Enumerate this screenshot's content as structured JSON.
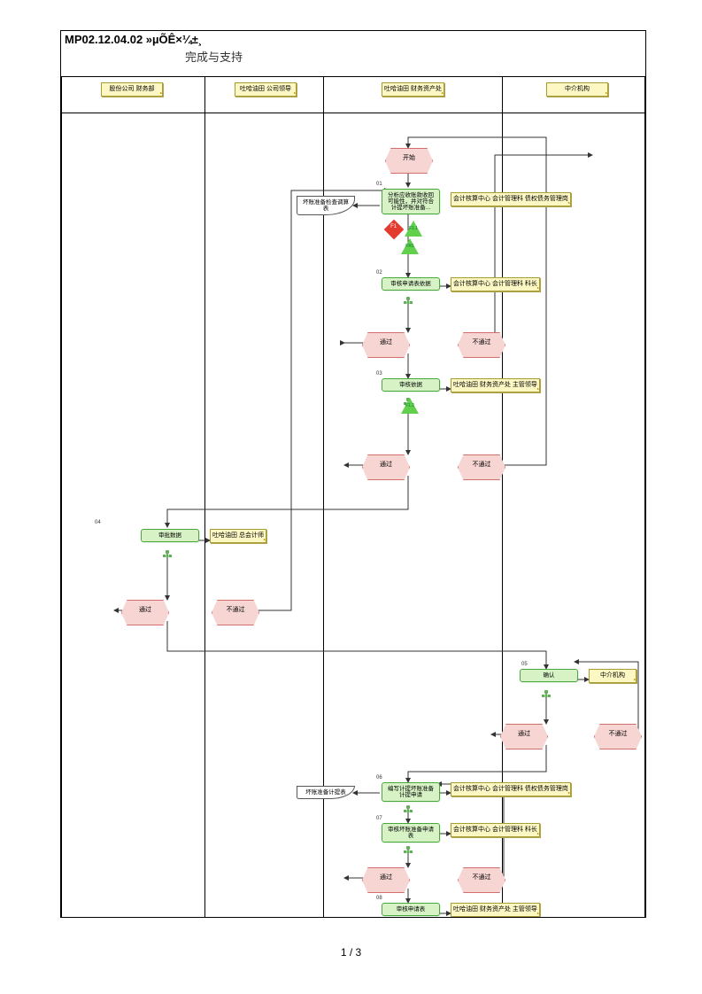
{
  "doc": {
    "code": "MP02.12.04.02 »µÕÊ×¼±¸",
    "subtitle": "完成与支持",
    "page_label": "1 / 3"
  },
  "lanes": {
    "l1": "股份公司\n财务部",
    "l2": "吐哈油田\n公司领导",
    "l3": "吐哈油田\n财务资产处",
    "l4": "中介机构"
  },
  "nodes": {
    "start": "开始",
    "s01": "分析应收账款收回可能性，并对符合计提坏账准备...",
    "s01_doc": "坏账准备检查调算表",
    "s01_org": "会计核算中心\n会计管理科\n债权债务管理岗",
    "s01_d": "F1",
    "s01_t1": "F1.1",
    "s01_t2": "FR1",
    "s02": "审核申请表依据",
    "s02_org": "会计核算中心\n会计管理科\n科长",
    "s02_pass": "通过",
    "s02_fail": "不通过",
    "s03": "审核依据",
    "s03_org": "吐哈油田\n财务资产处\n主管领导",
    "s03_t": "F1.2",
    "s03_pass": "通过",
    "s03_fail": "不通过",
    "s04": "审批数据",
    "s04_org": "吐哈油田\n总会计师",
    "s04_pass": "通过",
    "s04_fail": "不通过",
    "s05": "确认",
    "s05_org": "中介机构",
    "s05_pass": "通过",
    "s05_fail": "不通过",
    "s06": "编写计提坏账准备计提申请",
    "s06_doc": "坏账准备计提表",
    "s06_org": "会计核算中心\n会计管理科\n债权债务管理岗",
    "s07": "审核坏账准备申请表",
    "s07_org": "会计核算中心\n会计管理科\n科长",
    "s07_pass": "通过",
    "s07_fail": "不通过",
    "s08": "审核申请表",
    "s08_org": "吐哈油田\n财务资产处\n主管领导"
  },
  "numbers": {
    "n01": "01",
    "n02": "02",
    "n03": "03",
    "n04": "04",
    "n05": "05",
    "n06": "06",
    "n07": "07",
    "n08": "08"
  }
}
